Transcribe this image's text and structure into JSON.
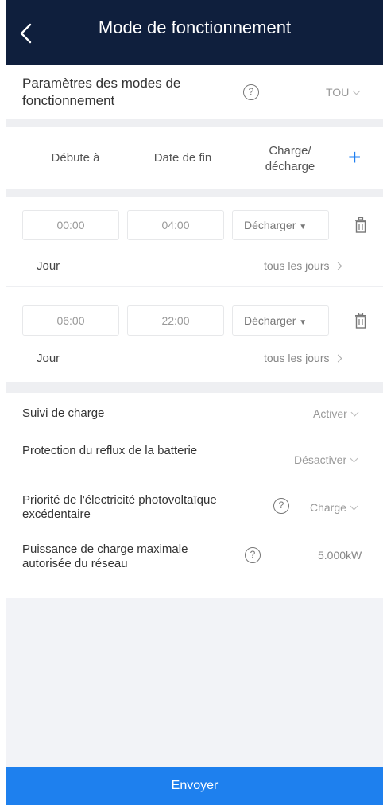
{
  "header": {
    "title": "Mode de fonctionnement"
  },
  "mode": {
    "label": "Paramètres des modes de fonctionnement",
    "value": "TOU"
  },
  "schedule": {
    "columns": [
      "Débute à",
      "Date de fin",
      "Charge/\ndécharge"
    ],
    "entries": [
      {
        "start": "00:00",
        "end": "04:00",
        "action": "Décharger",
        "day_label": "Jour",
        "day_value": "tous les jours"
      },
      {
        "start": "06:00",
        "end": "22:00",
        "action": "Décharger",
        "day_label": "Jour",
        "day_value": "tous les jours"
      }
    ]
  },
  "settings": [
    {
      "label": "Suivi de charge",
      "value": "Activer"
    },
    {
      "label": "Protection du reflux de la batterie",
      "value": "Désactiver"
    },
    {
      "label": "Priorité de l'électricité photovoltaïque excédentaire",
      "value": "Charge"
    },
    {
      "label": "Puissance de charge maximale autorisée du réseau",
      "value": "5.000kW"
    }
  ],
  "footer": {
    "submit_label": "Envoyer"
  },
  "colors": {
    "header": "#0f1f3d",
    "accent": "#1e80ee",
    "plus": "#1e7ef0"
  }
}
